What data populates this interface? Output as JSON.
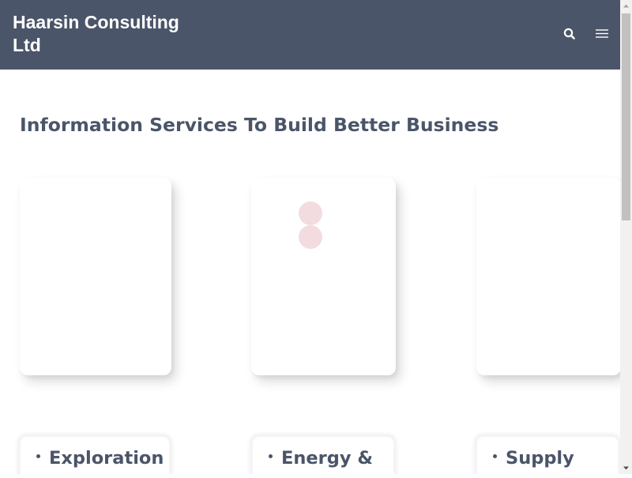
{
  "header": {
    "brand": "Haarsin Consulting Ltd",
    "search_icon": "search-icon",
    "menu_icon": "hamburger-menu-icon",
    "background": "#4b5569"
  },
  "main": {
    "headline": "Information Services To Build Better Business",
    "image_cards_count": 3,
    "loader_color": "#f3dcdf"
  },
  "services": [
    {
      "label": "Exploration"
    },
    {
      "label": "Energy &"
    },
    {
      "label": "Supply"
    }
  ],
  "colors": {
    "text": "#4b5569",
    "accent": "#4b5569"
  }
}
